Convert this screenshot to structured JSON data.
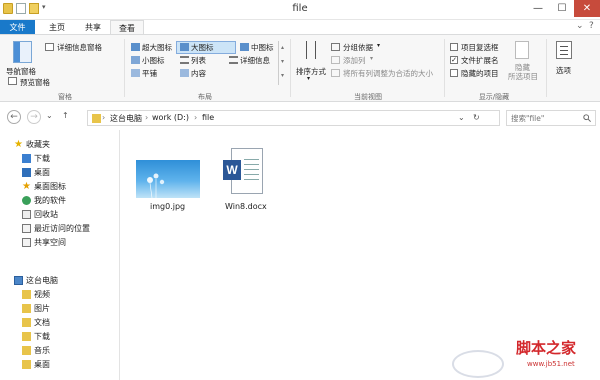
{
  "window": {
    "title": "file",
    "min_glyph": "—",
    "max_glyph": "☐",
    "close_glyph": "✕"
  },
  "tabs": [
    "文件",
    "主页",
    "共享",
    "查看"
  ],
  "help_glyphs": {
    "expand": "⌄",
    "help": "?"
  },
  "ribbon": {
    "pane": {
      "nav_pane": "导航窗格",
      "preview_pane": "预览窗格",
      "details_pane": "详细信息窗格",
      "label": "窗格"
    },
    "layout": {
      "extra_large": "超大图标",
      "large": "大图标",
      "medium": "中图标",
      "small": "小图标",
      "list": "列表",
      "details": "详细信息",
      "tiles": "平铺",
      "content": "内容",
      "label": "布局"
    },
    "current_view": {
      "sort_by": "排序方式",
      "group_by": "分组依据",
      "add_columns": "添加列",
      "size_all_columns": "将所有列调整为合适的大小",
      "label": "当前视图"
    },
    "show_hide": {
      "item_checkboxes": "项目复选框",
      "file_extensions": "文件扩展名",
      "hidden_items": "隐藏的项目",
      "hide": "隐藏",
      "selected_items": "所选项目",
      "options": "选项",
      "label": "显示/隐藏",
      "checkmark": "✓"
    }
  },
  "address": {
    "back": "←",
    "forward": "→",
    "dropdown": "⌄",
    "up": "↑",
    "crumbs": [
      "这台电脑",
      "work (D:)",
      "file"
    ],
    "sep": "›",
    "search_placeholder": "搜索\"file\""
  },
  "nav_pane": {
    "favorites": "收藏夹",
    "fav_items": [
      "下载",
      "桌面",
      "桌面图标",
      "我的软件",
      "回收站",
      "最近访问的位置",
      "共享空间"
    ],
    "this_pc": "这台电脑",
    "pc_items": [
      "视频",
      "图片",
      "文档",
      "下载",
      "音乐",
      "桌面"
    ]
  },
  "files": [
    {
      "name": "img0.jpg",
      "icon": "image-thumbnail"
    },
    {
      "name": "Win8.docx",
      "icon": "word-document-icon",
      "glyph": "W"
    }
  ],
  "watermark": {
    "brand": "脚本之家",
    "url": "www.jb51.net"
  },
  "colors": {
    "file_tab": "#1979ca",
    "close_button": "#c74b3c",
    "selection": "#cce4f7",
    "word_blue": "#2b5797"
  }
}
